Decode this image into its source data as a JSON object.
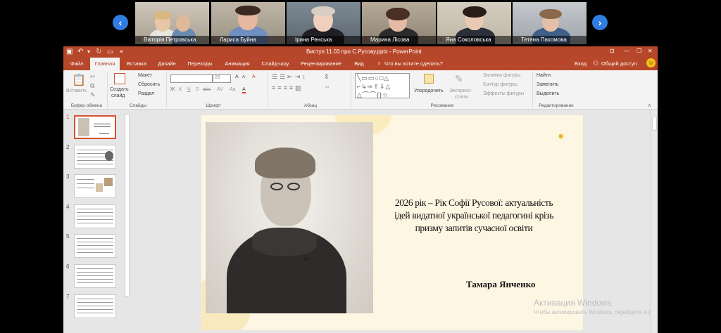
{
  "participants": [
    {
      "name": "Вікторія Петровська"
    },
    {
      "name": "Лариса Буйна"
    },
    {
      "name": "Ірина Ренська"
    },
    {
      "name": "Марина Лісова"
    },
    {
      "name": "Яна Соколовська"
    },
    {
      "name": "Тетяна Пахомова"
    }
  ],
  "nav": {
    "prev": "‹",
    "next": "›"
  },
  "window": {
    "title": "Виступ  11.03 про С.Русову.pptx - PowerPoint",
    "controls": {
      "ribbon_opts": "⊡",
      "minimize": "—",
      "restore": "❐",
      "close": "✕"
    }
  },
  "tabs": [
    "Файл",
    "Главная",
    "Вставка",
    "Дизайн",
    "Переходы",
    "Анимация",
    "Слайд-шоу",
    "Рецензирование",
    "Вид"
  ],
  "active_tab": 1,
  "tell_me": "Что вы хотите сделать?",
  "signin": "Вход",
  "share": "Общий доступ",
  "ribbon": {
    "clipboard": {
      "paste": "Вставить",
      "group": "Буфер обмена"
    },
    "slides": {
      "new_slide_1": "Создать",
      "new_slide_2": "слайд",
      "layout": "Макет",
      "reset": "Сбросить",
      "section": "Раздел",
      "group": "Слайды"
    },
    "font": {
      "size": "28",
      "bold": "Ж",
      "italic": "К",
      "underline": "Ч",
      "strike": "S",
      "shadow": "abc",
      "spacing": "AV",
      "case": "Aa",
      "grow": "A",
      "shrink": "A",
      "clear": "A",
      "color": "A",
      "group": "Шрифт"
    },
    "paragraph": {
      "group": "Абзац"
    },
    "drawing": {
      "arrange": "Упорядочить",
      "quick_styles_1": "Экспресс-",
      "quick_styles_2": "стили",
      "fill": "Заливка фигуры",
      "outline": "Контур фигуры",
      "effects": "Эффекты фигуры",
      "group": "Рисование"
    },
    "editing": {
      "find": "Найти",
      "replace": "Заменить",
      "select": "Выделить",
      "group": "Редактирование"
    }
  },
  "thumbnails": [
    "1",
    "2",
    "3",
    "4",
    "5",
    "6",
    "7"
  ],
  "slide": {
    "title_line1": "2026 рік – Рік Софії Русової: актуальність",
    "title_line2": "ідей видатної української педагогині крізь",
    "title_line3": "призму запитів сучасної освіти",
    "author": "Тамара Янченко"
  },
  "watermark": {
    "line1": "Активация Windows",
    "line2": "Чтобы активировать Windows, перейдите в раздел"
  }
}
